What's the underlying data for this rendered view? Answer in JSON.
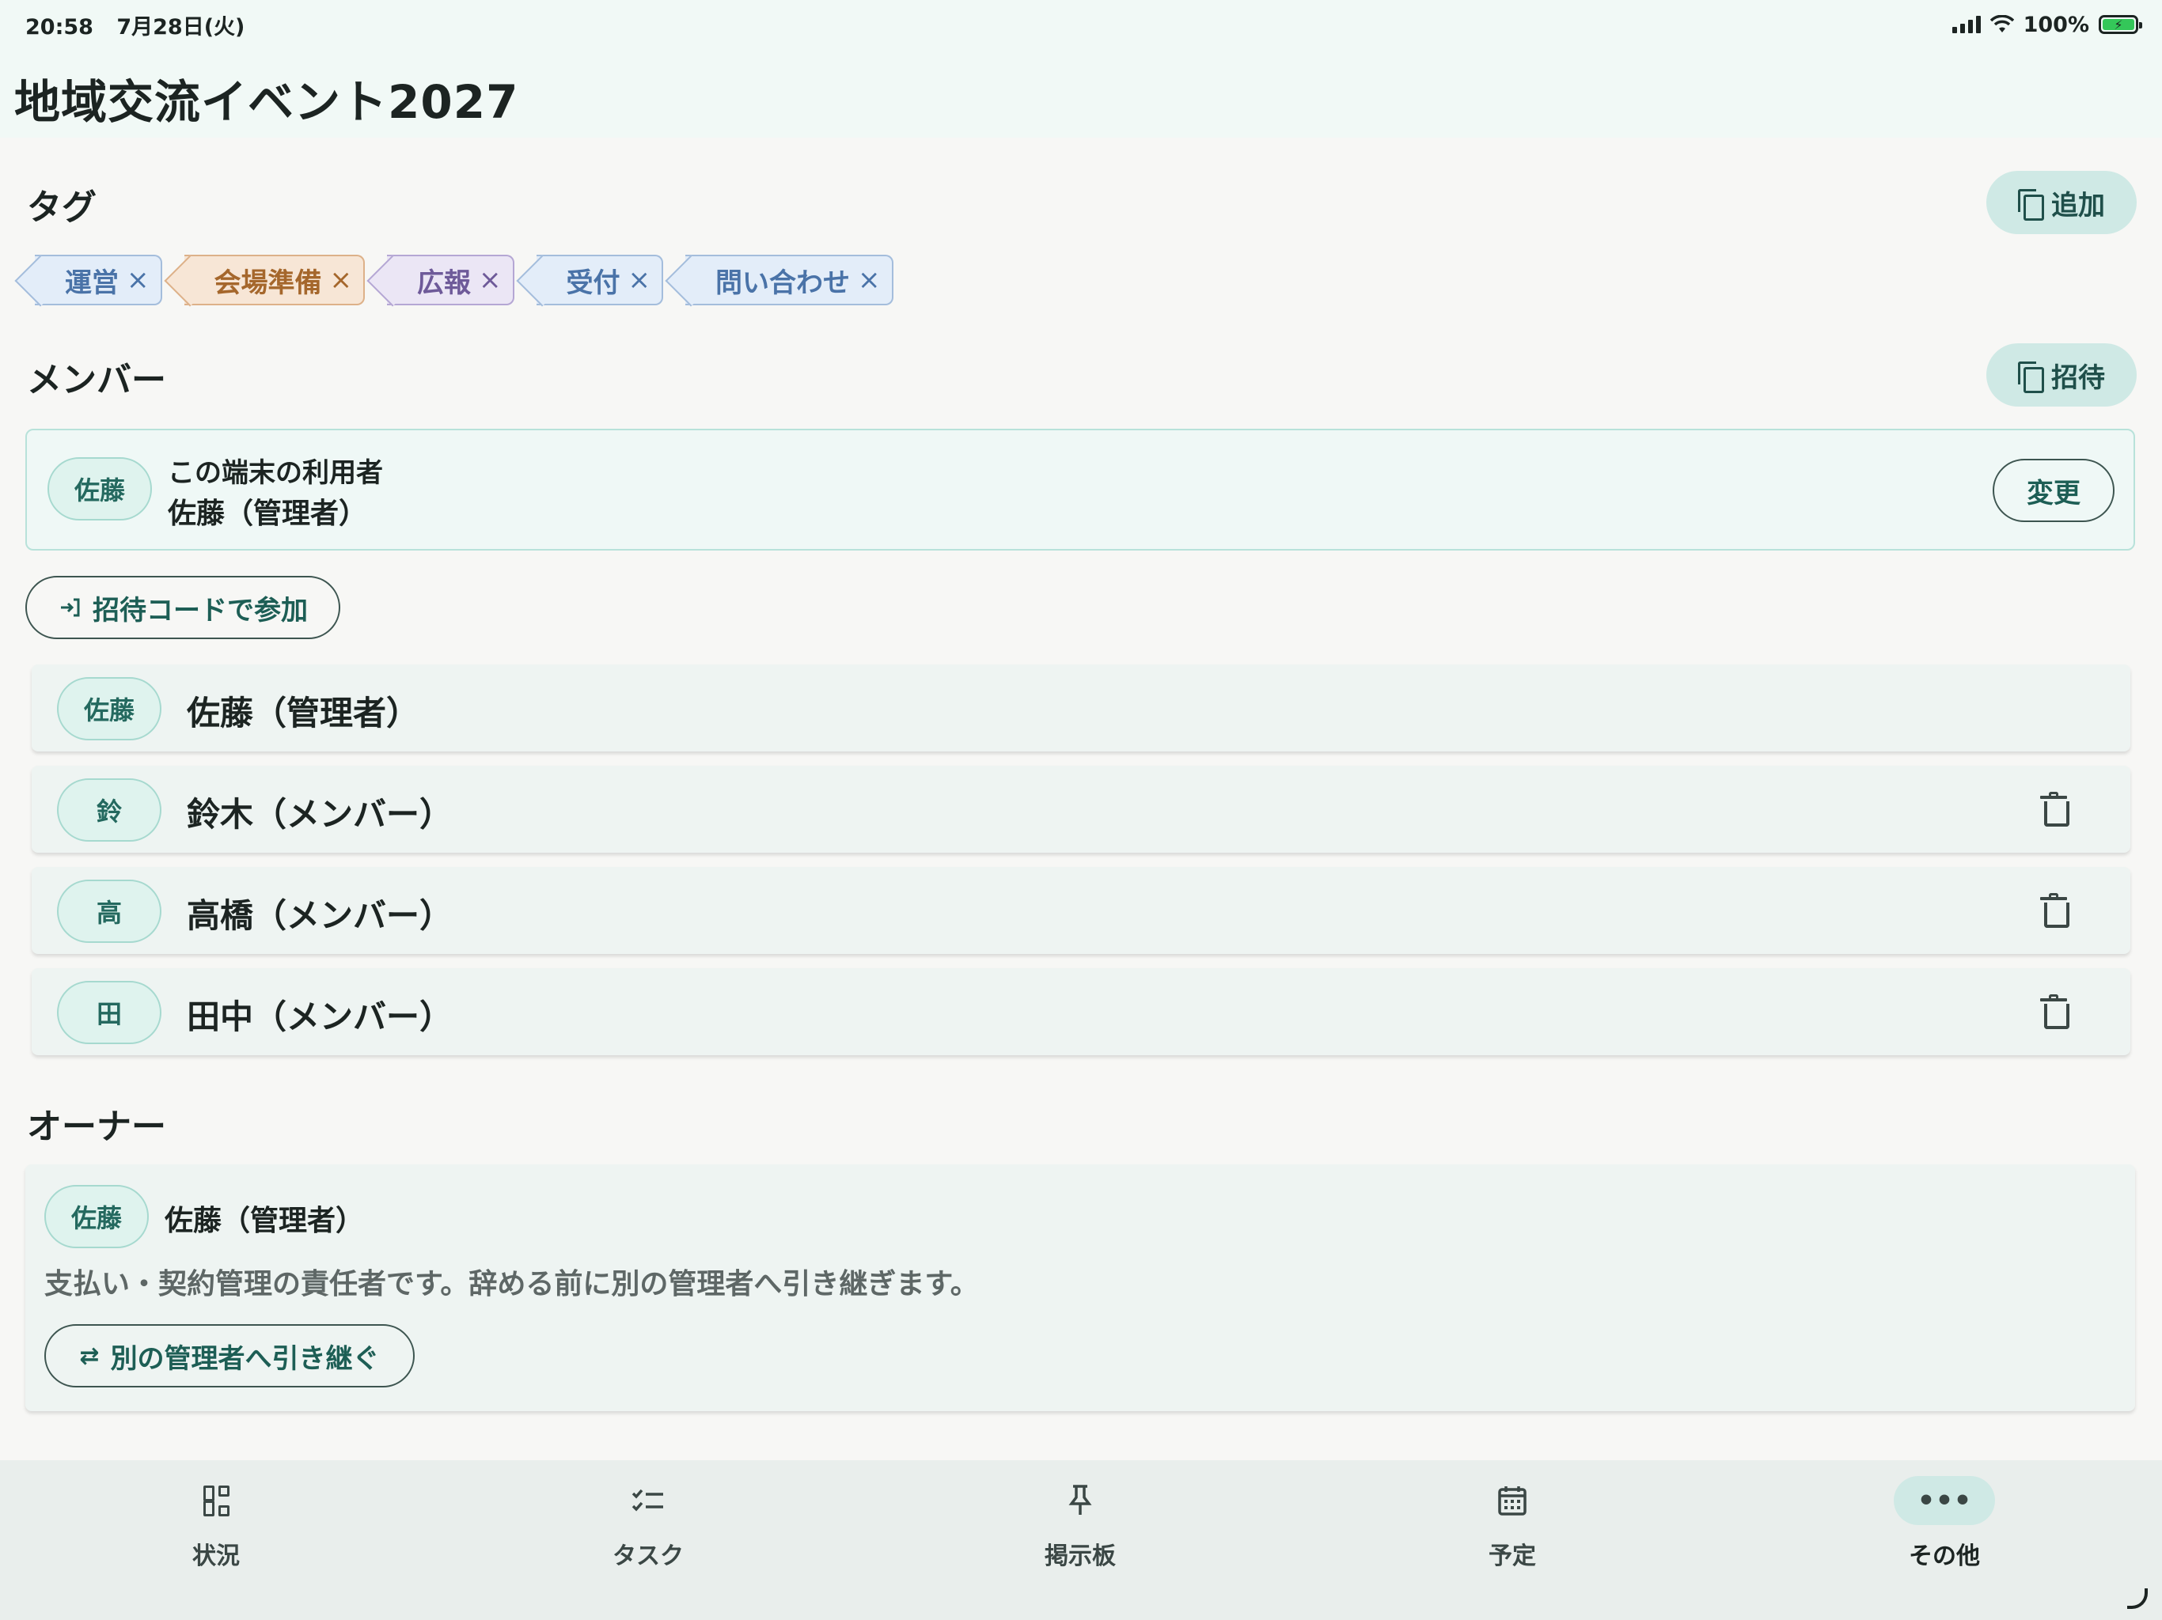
{
  "status_bar": {
    "time": "20:58",
    "date": "7月28日(火)",
    "battery": "100%"
  },
  "header": {
    "title": "地域交流イベント2027"
  },
  "tags_section": {
    "title": "タグ",
    "add_label": "追加",
    "tags": [
      {
        "label": "運営",
        "color": "blue"
      },
      {
        "label": "会場準備",
        "color": "orange"
      },
      {
        "label": "広報",
        "color": "purple"
      },
      {
        "label": "受付",
        "color": "blue"
      },
      {
        "label": "問い合わせ",
        "color": "blue"
      }
    ],
    "remove_glyph": "×"
  },
  "members_section": {
    "title": "メンバー",
    "invite_label": "招待",
    "device_user": {
      "avatar": "佐藤",
      "label": "この端末の利用者",
      "name": "佐藤（管理者）",
      "change_label": "変更"
    },
    "join_by_code_label": "招待コードで参加",
    "members": [
      {
        "avatar": "佐藤",
        "name": "佐藤（管理者）",
        "deletable": false
      },
      {
        "avatar": "鈴",
        "name": "鈴木（メンバー）",
        "deletable": true
      },
      {
        "avatar": "高",
        "name": "高橋（メンバー）",
        "deletable": true
      },
      {
        "avatar": "田",
        "name": "田中（メンバー）",
        "deletable": true
      }
    ]
  },
  "owner_section": {
    "title": "オーナー",
    "avatar": "佐藤",
    "name": "佐藤（管理者）",
    "description": "支払い・契約管理の責任者です。辞める前に別の管理者へ引き継ぎます。",
    "transfer_label": "別の管理者へ引き継ぐ"
  },
  "tabbar": {
    "tabs": [
      {
        "label": "状況",
        "icon": "dashboard-icon",
        "active": false
      },
      {
        "label": "タスク",
        "icon": "checklist-icon",
        "active": false
      },
      {
        "label": "掲示板",
        "icon": "pin-icon",
        "active": false
      },
      {
        "label": "予定",
        "icon": "calendar-icon",
        "active": false
      },
      {
        "label": "その他",
        "icon": "more-icon",
        "active": true
      }
    ]
  },
  "colors": {
    "accent": "#1f4f4a",
    "accent_bg": "#cfe9e5",
    "tag_blue": "#4a73a8",
    "tag_orange": "#a5672c",
    "tag_purple": "#6e5a99"
  }
}
